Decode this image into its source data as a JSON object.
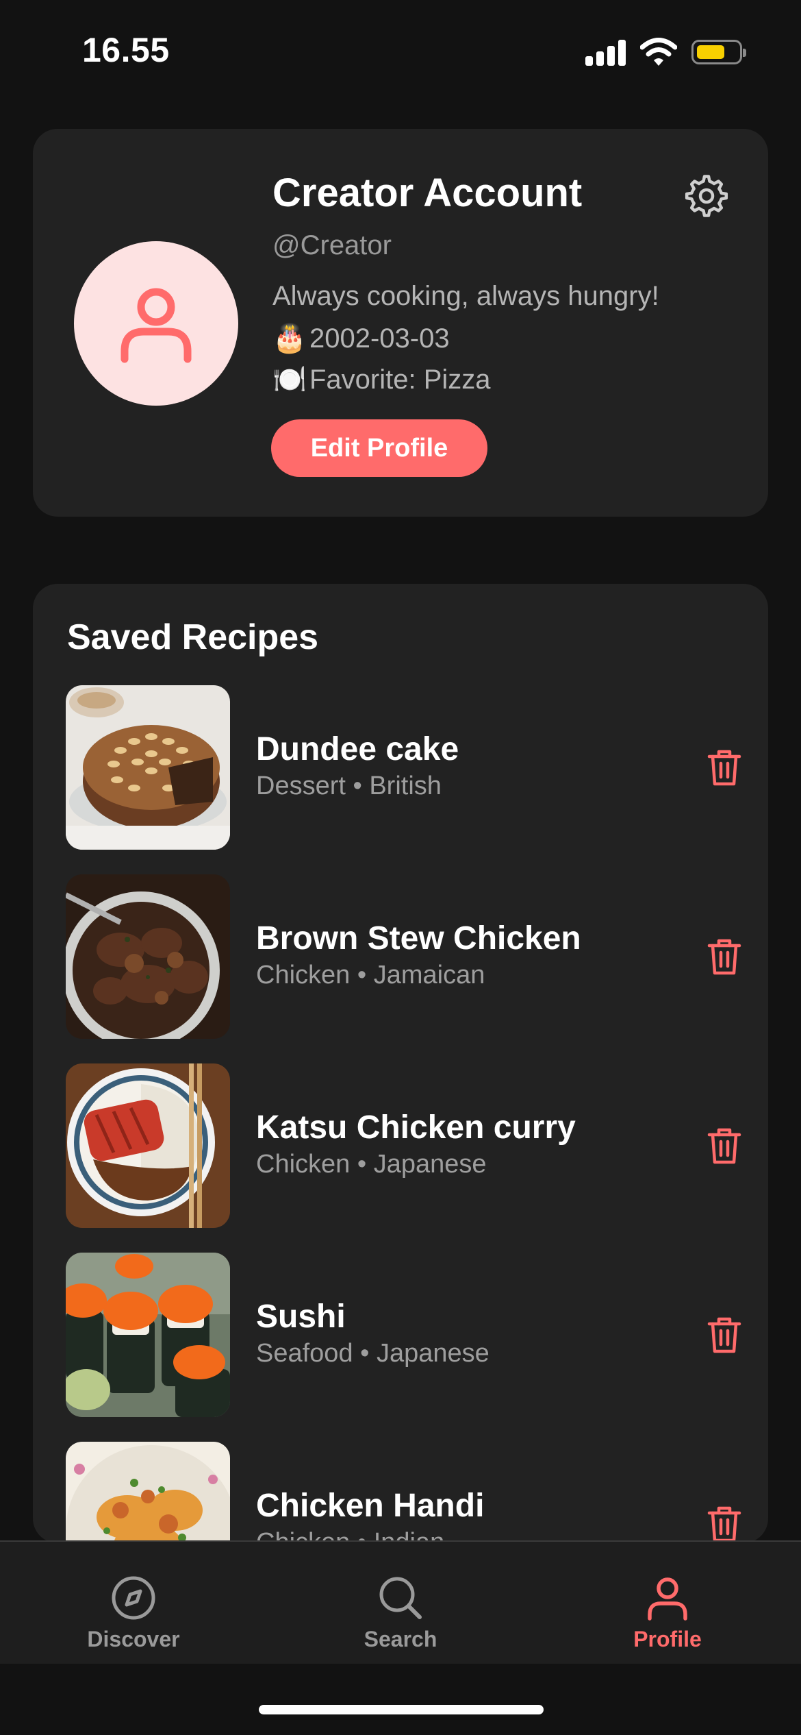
{
  "status_bar": {
    "time": "16.55"
  },
  "profile": {
    "name": "Creator Account",
    "handle": "@Creator",
    "bio": "Always cooking, always hungry!",
    "birthday_emoji": "🎂",
    "birthday": "2002-03-03",
    "favorite_emoji": "🍽️",
    "favorite": "Favorite: Pizza",
    "edit_label": "Edit Profile",
    "avatar_icon": "user-icon",
    "settings_icon": "gear-icon"
  },
  "saved": {
    "title": "Saved Recipes",
    "recipes": [
      {
        "title": "Dundee cake",
        "meta": "Dessert • British"
      },
      {
        "title": "Brown Stew Chicken",
        "meta": "Chicken • Jamaican"
      },
      {
        "title": "Katsu Chicken curry",
        "meta": "Chicken • Japanese"
      },
      {
        "title": "Sushi",
        "meta": "Seafood • Japanese"
      },
      {
        "title": "Chicken Handi",
        "meta": "Chicken • Indian"
      }
    ]
  },
  "tabs": {
    "discover": "Discover",
    "search": "Search",
    "profile": "Profile"
  },
  "colors": {
    "accent": "#ff6b6b",
    "background": "#121212",
    "card": "#222222",
    "avatar_bg": "#fde2e2"
  }
}
